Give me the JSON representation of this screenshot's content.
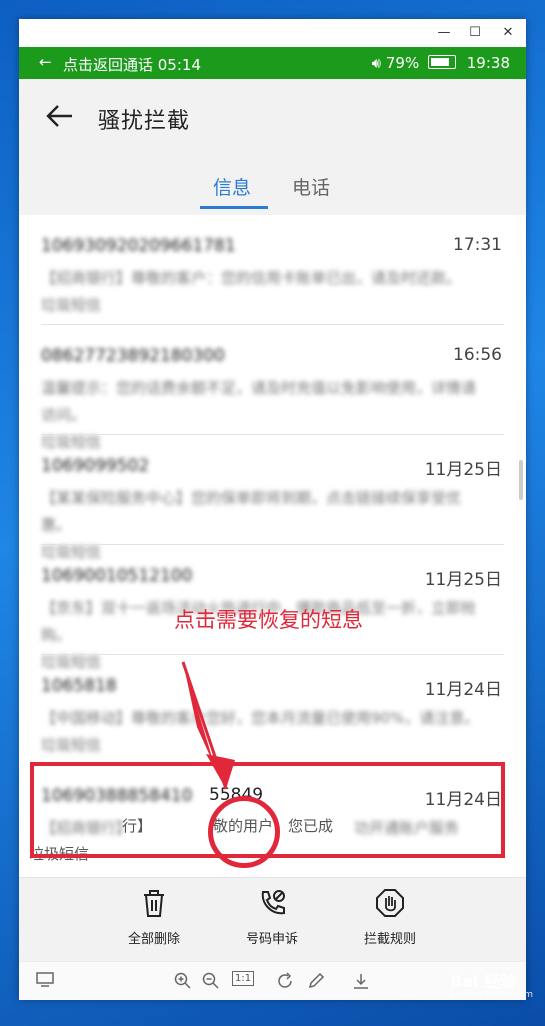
{
  "call_bar": {
    "text": "点击返回通话 05:14",
    "battery": "79%",
    "time": "19:38"
  },
  "header": {
    "title": "骚扰拦截"
  },
  "tabs": [
    {
      "label": "信息"
    },
    {
      "label": "电话"
    }
  ],
  "messages": [
    {
      "sender": "106930920209661781",
      "date": "17:31",
      "preview": "【招商银行】尊敬的客户：您的信用卡账单已出，请及时还款。",
      "tag": "垃圾短信"
    },
    {
      "sender": "08627723892180300",
      "date": "16:56",
      "preview": "温馨提示：您的话费余额不足，请及时充值以免影响使用，详情请访问。",
      "tag": "垃圾短信"
    },
    {
      "sender": "1069099502",
      "date": "11月25日",
      "preview": "【某某保险服务中心】您的保单即将到期，点击链接续保享受优惠。",
      "tag": "垃圾短信"
    },
    {
      "sender": "10690010512100",
      "date": "11月25日",
      "preview": "【京东】双十一返场活动火热进行中，爆款商品低至一折，立即抢购。",
      "tag": "垃圾短信"
    },
    {
      "sender": "1065818",
      "date": "11月24日",
      "preview": "【中国移动】尊敬的客户您好，您本月流量已使用90%，请注意。",
      "tag": "垃圾短信"
    },
    {
      "sender": "10690388858410",
      "sender_visible": "55849",
      "date": "11月24日",
      "preview_blur_1": "【招商银行】尊",
      "preview_visible_1": "行】",
      "preview_visible_2": "敬的用户，您已成",
      "preview_blur_2": "功开通账户服务",
      "tag": "垃圾短信"
    }
  ],
  "annotation": {
    "text": "点击需要恢复的短息"
  },
  "toolbar": [
    {
      "label": "全部删除",
      "icon": "trash-icon"
    },
    {
      "label": "号码申诉",
      "icon": "phone-appeal-icon"
    },
    {
      "label": "拦截规则",
      "icon": "block-hand-icon"
    }
  ],
  "viewer_bar": {
    "zoom_reset": "1:1"
  },
  "watermark": {
    "brand": "Bai 经验",
    "url": "jingyan.baidu.com"
  },
  "colors": {
    "call_green": "#1c9a1c",
    "accent_blue": "#2a7bd6",
    "annotation_red": "#e0283a"
  }
}
